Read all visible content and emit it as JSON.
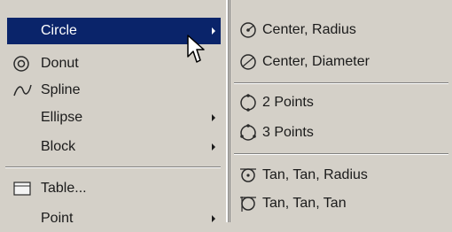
{
  "main_menu": {
    "items": [
      {
        "label": "Circle",
        "icon": "circle-icon",
        "has_submenu": true,
        "highlighted": true
      },
      {
        "label": "Donut",
        "icon": "donut-icon",
        "has_submenu": false
      },
      {
        "label": "Spline",
        "icon": "spline-icon",
        "has_submenu": false
      },
      {
        "label": "Ellipse",
        "icon": "",
        "has_submenu": true
      },
      {
        "label": "Block",
        "icon": "",
        "has_submenu": true
      },
      {
        "label": "Table...",
        "icon": "table-icon",
        "has_submenu": false
      },
      {
        "label": "Point",
        "icon": "",
        "has_submenu": true
      }
    ]
  },
  "circle_submenu": {
    "items": [
      {
        "label": "Center, Radius",
        "icon": "circle-center-radius-icon"
      },
      {
        "label": "Center, Diameter",
        "icon": "circle-center-diameter-icon"
      },
      {
        "label": "2 Points",
        "icon": "circle-2-points-icon"
      },
      {
        "label": "3 Points",
        "icon": "circle-3-points-icon"
      },
      {
        "label": "Tan, Tan, Radius",
        "icon": "circle-tan-tan-radius-icon"
      },
      {
        "label": "Tan, Tan, Tan",
        "icon": "circle-tan-tan-tan-icon"
      }
    ]
  },
  "colors": {
    "menu_bg": "#d4d0c8",
    "highlight_bg": "#0a246a",
    "highlight_text": "#ffffff"
  }
}
